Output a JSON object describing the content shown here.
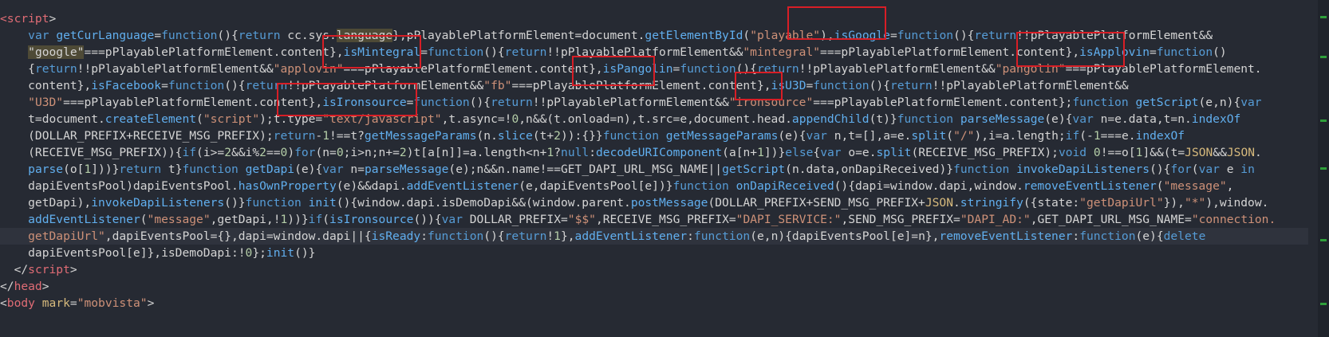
{
  "colors": {
    "background": "#262a33",
    "highlight_line": "#2f333d",
    "annotation_box": "#d81e26",
    "minimap_marker": "#2f9f3b"
  },
  "code_lines": [
    [
      [
        "g",
        "<script"
      ],
      [
        "m",
        ">"
      ]
    ],
    [
      [
        "m",
        "    "
      ],
      [
        "k",
        "var"
      ],
      [
        "m",
        " "
      ],
      [
        "f",
        "getCurLanguage"
      ],
      [
        "m",
        "="
      ],
      [
        "k",
        "function"
      ],
      [
        "m",
        "(){"
      ],
      [
        "k",
        "return"
      ],
      [
        "m",
        " cc.sys."
      ],
      [
        "w",
        "language"
      ],
      [
        "m",
        "},pPlayablePlatformElement=document."
      ],
      [
        "f",
        "getElementById"
      ],
      [
        "m",
        "("
      ],
      [
        "s",
        "\"playable\""
      ],
      [
        "m",
        "),"
      ],
      [
        "f",
        "isGoogle"
      ],
      [
        "m",
        "="
      ],
      [
        "k",
        "function"
      ],
      [
        "m",
        "(){"
      ],
      [
        "k",
        "return"
      ],
      [
        "m",
        "!!pPlayablePlatformElement&&"
      ]
    ],
    [
      [
        "m",
        "    "
      ],
      [
        "w",
        "\"google\""
      ],
      [
        "m",
        "===pPlayablePlatformElement.content},"
      ],
      [
        "f",
        "isMintegral"
      ],
      [
        "m",
        "="
      ],
      [
        "k",
        "function"
      ],
      [
        "m",
        "(){"
      ],
      [
        "k",
        "return"
      ],
      [
        "m",
        "!!pPlayablePlatformElement&&"
      ],
      [
        "s",
        "\"mintegral\""
      ],
      [
        "m",
        "===pPlayablePlatformElement.content},"
      ],
      [
        "f",
        "isApplovin"
      ],
      [
        "m",
        "="
      ],
      [
        "k",
        "function"
      ],
      [
        "m",
        "()"
      ]
    ],
    [
      [
        "m",
        "    {"
      ],
      [
        "k",
        "return"
      ],
      [
        "m",
        "!!pPlayablePlatformElement&&"
      ],
      [
        "s",
        "\"applovin\""
      ],
      [
        "m",
        "===pPlayablePlatformElement.content},"
      ],
      [
        "f",
        "isPangolin"
      ],
      [
        "m",
        "="
      ],
      [
        "k",
        "function"
      ],
      [
        "m",
        "(){"
      ],
      [
        "k",
        "return"
      ],
      [
        "m",
        "!!pPlayablePlatformElement&&"
      ],
      [
        "s",
        "\"pangolin\""
      ],
      [
        "m",
        "===pPlayablePlatformElement."
      ]
    ],
    [
      [
        "m",
        "    content},"
      ],
      [
        "f",
        "isFacebook"
      ],
      [
        "m",
        "="
      ],
      [
        "k",
        "function"
      ],
      [
        "m",
        "(){"
      ],
      [
        "k",
        "return"
      ],
      [
        "m",
        "!!pPlayablePlatformElement&&"
      ],
      [
        "s",
        "\"fb\""
      ],
      [
        "m",
        "===pPlayablePlatformElement.content},"
      ],
      [
        "f",
        "isU3D"
      ],
      [
        "m",
        "="
      ],
      [
        "k",
        "function"
      ],
      [
        "m",
        "(){"
      ],
      [
        "k",
        "return"
      ],
      [
        "m",
        "!!pPlayablePlatformElement&&"
      ]
    ],
    [
      [
        "m",
        "    "
      ],
      [
        "s",
        "\"U3D\""
      ],
      [
        "m",
        "===pPlayablePlatformElement.content},"
      ],
      [
        "f",
        "isIronsource"
      ],
      [
        "m",
        "="
      ],
      [
        "k",
        "function"
      ],
      [
        "m",
        "(){"
      ],
      [
        "k",
        "return"
      ],
      [
        "m",
        "!!pPlayablePlatformElement&&"
      ],
      [
        "s",
        "\"ironsource\""
      ],
      [
        "m",
        "===pPlayablePlatformElement.content};"
      ],
      [
        "k",
        "function"
      ],
      [
        "m",
        " "
      ],
      [
        "f",
        "getScript"
      ],
      [
        "m",
        "(e,n){"
      ],
      [
        "k",
        "var"
      ]
    ],
    [
      [
        "m",
        "    t=document."
      ],
      [
        "f",
        "createElement"
      ],
      [
        "m",
        "("
      ],
      [
        "s",
        "\"script\""
      ],
      [
        "m",
        ");t.type="
      ],
      [
        "s",
        "\"text/javascript\""
      ],
      [
        "m",
        ",t.async=!"
      ],
      [
        "n",
        "0"
      ],
      [
        "m",
        ",n&&(t.onload=n),t.src=e,document.head."
      ],
      [
        "f",
        "appendChild"
      ],
      [
        "m",
        "(t)}"
      ],
      [
        "k",
        "function"
      ],
      [
        "m",
        " "
      ],
      [
        "f",
        "parseMessage"
      ],
      [
        "m",
        "(e){"
      ],
      [
        "k",
        "var"
      ],
      [
        "m",
        " n=e.data,t=n."
      ],
      [
        "f",
        "indexOf"
      ]
    ],
    [
      [
        "m",
        "    (DOLLAR_PREFIX+RECEIVE_MSG_PREFIX);"
      ],
      [
        "k",
        "return"
      ],
      [
        "m",
        "-"
      ],
      [
        "n",
        "1"
      ],
      [
        "m",
        "!==t?"
      ],
      [
        "f",
        "getMessageParams"
      ],
      [
        "m",
        "(n."
      ],
      [
        "f",
        "slice"
      ],
      [
        "m",
        "(t+"
      ],
      [
        "n",
        "2"
      ],
      [
        "m",
        "))"
      ],
      [
        "m",
        ":{}}"
      ],
      [
        "k",
        "function"
      ],
      [
        "m",
        " "
      ],
      [
        "f",
        "getMessageParams"
      ],
      [
        "m",
        "(e){"
      ],
      [
        "k",
        "var"
      ],
      [
        "m",
        " n,t=[],a=e."
      ],
      [
        "f",
        "split"
      ],
      [
        "m",
        "("
      ],
      [
        "s",
        "\"/\""
      ],
      [
        "m",
        "),i=a.length;"
      ],
      [
        "k",
        "if"
      ],
      [
        "m",
        "(-"
      ],
      [
        "n",
        "1"
      ],
      [
        "m",
        "===e."
      ],
      [
        "f",
        "indexOf"
      ]
    ],
    [
      [
        "m",
        "    (RECEIVE_MSG_PREFIX)){"
      ],
      [
        "k",
        "if"
      ],
      [
        "m",
        "(i>="
      ],
      [
        "n",
        "2"
      ],
      [
        "m",
        "&&i%"
      ],
      [
        "n",
        "2"
      ],
      [
        "m",
        "=="
      ],
      [
        "n",
        "0"
      ],
      [
        "m",
        ")"
      ],
      [
        "k",
        "for"
      ],
      [
        "m",
        "(n="
      ],
      [
        "n",
        "0"
      ],
      [
        "m",
        ";i>n;n+="
      ],
      [
        "n",
        "2"
      ],
      [
        "m",
        ")t[a[n]]=a.length<n+"
      ],
      [
        "n",
        "1"
      ],
      [
        "m",
        "?"
      ],
      [
        "k",
        "null"
      ],
      [
        "m",
        ":"
      ],
      [
        "f",
        "decodeURIComponent"
      ],
      [
        "m",
        "(a[n+"
      ],
      [
        "n",
        "1"
      ],
      [
        "m",
        "])}"
      ],
      [
        "k",
        "else"
      ],
      [
        "m",
        "{"
      ],
      [
        "k",
        "var"
      ],
      [
        "m",
        " o=e."
      ],
      [
        "f",
        "split"
      ],
      [
        "m",
        "(RECEIVE_MSG_PREFIX);"
      ],
      [
        "k",
        "void"
      ],
      [
        "m",
        " "
      ],
      [
        "n",
        "0"
      ],
      [
        "m",
        "!==o["
      ],
      [
        "n",
        "1"
      ],
      [
        "m",
        "]&&(t="
      ],
      [
        "b",
        "JSON"
      ],
      [
        "m",
        "&&"
      ],
      [
        "b",
        "JSON"
      ],
      [
        "m",
        "."
      ]
    ],
    [
      [
        "m",
        "    "
      ],
      [
        "f",
        "parse"
      ],
      [
        "m",
        "(o["
      ],
      [
        "n",
        "1"
      ],
      [
        "m",
        "]))}"
      ],
      [
        "k",
        "return"
      ],
      [
        "m",
        " t}"
      ],
      [
        "k",
        "function"
      ],
      [
        "m",
        " "
      ],
      [
        "f",
        "getDapi"
      ],
      [
        "m",
        "(e){"
      ],
      [
        "k",
        "var"
      ],
      [
        "m",
        " n="
      ],
      [
        "f",
        "parseMessage"
      ],
      [
        "m",
        "(e);n&&n.name!==GET_DAPI_URL_MSG_NAME||"
      ],
      [
        "f",
        "getScript"
      ],
      [
        "m",
        "(n.data,onDapiReceived)}"
      ],
      [
        "k",
        "function"
      ],
      [
        "m",
        " "
      ],
      [
        "f",
        "invokeDapiListeners"
      ],
      [
        "m",
        "(){"
      ],
      [
        "k",
        "for"
      ],
      [
        "m",
        "("
      ],
      [
        "k",
        "var"
      ],
      [
        "m",
        " e "
      ],
      [
        "k",
        "in"
      ]
    ],
    [
      [
        "m",
        "    dapiEventsPool)dapiEventsPool."
      ],
      [
        "f",
        "hasOwnProperty"
      ],
      [
        "m",
        "(e)&&dapi."
      ],
      [
        "f",
        "addEventListener"
      ],
      [
        "m",
        "(e,dapiEventsPool[e])}"
      ],
      [
        "k",
        "function"
      ],
      [
        "m",
        " "
      ],
      [
        "f",
        "onDapiReceived"
      ],
      [
        "m",
        "(){dapi=window.dapi,window."
      ],
      [
        "f",
        "removeEventListener"
      ],
      [
        "m",
        "("
      ],
      [
        "s",
        "\"message\""
      ],
      [
        "m",
        ","
      ]
    ],
    [
      [
        "m",
        "    getDapi),"
      ],
      [
        "f",
        "invokeDapiListeners"
      ],
      [
        "m",
        "()}"
      ],
      [
        "k",
        "function"
      ],
      [
        "m",
        " "
      ],
      [
        "f",
        "init"
      ],
      [
        "m",
        "(){window.dapi.isDemoDapi&&(window.parent."
      ],
      [
        "f",
        "postMessage"
      ],
      [
        "m",
        "(DOLLAR_PREFIX+SEND_MSG_PREFIX+"
      ],
      [
        "b",
        "JSON"
      ],
      [
        "m",
        "."
      ],
      [
        "f",
        "stringify"
      ],
      [
        "m",
        "({state:"
      ],
      [
        "s",
        "\"getDapiUrl\""
      ],
      [
        "m",
        "}),"
      ],
      [
        "s",
        "\"*\""
      ],
      [
        "m",
        "),window."
      ]
    ],
    [
      [
        "m",
        "    "
      ],
      [
        "f",
        "addEventListener"
      ],
      [
        "m",
        "("
      ],
      [
        "s",
        "\"message\""
      ],
      [
        "m",
        ",getDapi,!"
      ],
      [
        "n",
        "1"
      ],
      [
        "m",
        "))}"
      ],
      [
        "k",
        "if"
      ],
      [
        "m",
        "("
      ],
      [
        "f",
        "isIronsource"
      ],
      [
        "m",
        "()){"
      ],
      [
        "k",
        "var"
      ],
      [
        "m",
        " DOLLAR_PREFIX="
      ],
      [
        "s",
        "\"$$\""
      ],
      [
        "m",
        ",RECEIVE_MSG_PREFIX="
      ],
      [
        "s",
        "\"DAPI_SERVICE:\""
      ],
      [
        "m",
        ",SEND_MSG_PREFIX="
      ],
      [
        "s",
        "\"DAPI_AD:\""
      ],
      [
        "m",
        ",GET_DAPI_URL_MSG_NAME="
      ],
      [
        "s",
        "\"connection."
      ]
    ],
    [
      [
        "s",
        "    getDapiUrl\""
      ],
      [
        "m",
        ",dapiEventsPool={},dapi=window.dapi||{"
      ],
      [
        "f",
        "isReady"
      ],
      [
        "m",
        ":"
      ],
      [
        "k",
        "function"
      ],
      [
        "m",
        "(){"
      ],
      [
        "k",
        "return"
      ],
      [
        "m",
        "!"
      ],
      [
        "n",
        "1"
      ],
      [
        "m",
        "},"
      ],
      [
        "f",
        "addEventListener"
      ],
      [
        "m",
        ":"
      ],
      [
        "k",
        "function"
      ],
      [
        "m",
        "(e,n){dapiEventsPool[e]=n},"
      ],
      [
        "f",
        "removeEventListener"
      ],
      [
        "m",
        ":"
      ],
      [
        "k",
        "function"
      ],
      [
        "m",
        "(e){"
      ],
      [
        "k",
        "delete"
      ]
    ],
    [
      [
        "m",
        "    dapiEventsPool[e]},isDemoDapi:!"
      ],
      [
        "n",
        "0"
      ],
      [
        "m",
        "};"
      ],
      [
        "f",
        "init"
      ],
      [
        "m",
        "()}"
      ]
    ],
    [
      [
        "m",
        "  </"
      ],
      [
        "g",
        "script"
      ],
      [
        "m",
        ">"
      ]
    ],
    [
      [
        "m",
        "</"
      ],
      [
        "g",
        "head"
      ],
      [
        "m",
        ">"
      ]
    ],
    [
      [
        "m",
        "<"
      ],
      [
        "g",
        "body"
      ],
      [
        "m",
        " "
      ],
      [
        "b",
        "mark"
      ],
      [
        "m",
        "="
      ],
      [
        "s",
        "\"mobvista\""
      ],
      [
        "m",
        ">"
      ]
    ]
  ]
}
